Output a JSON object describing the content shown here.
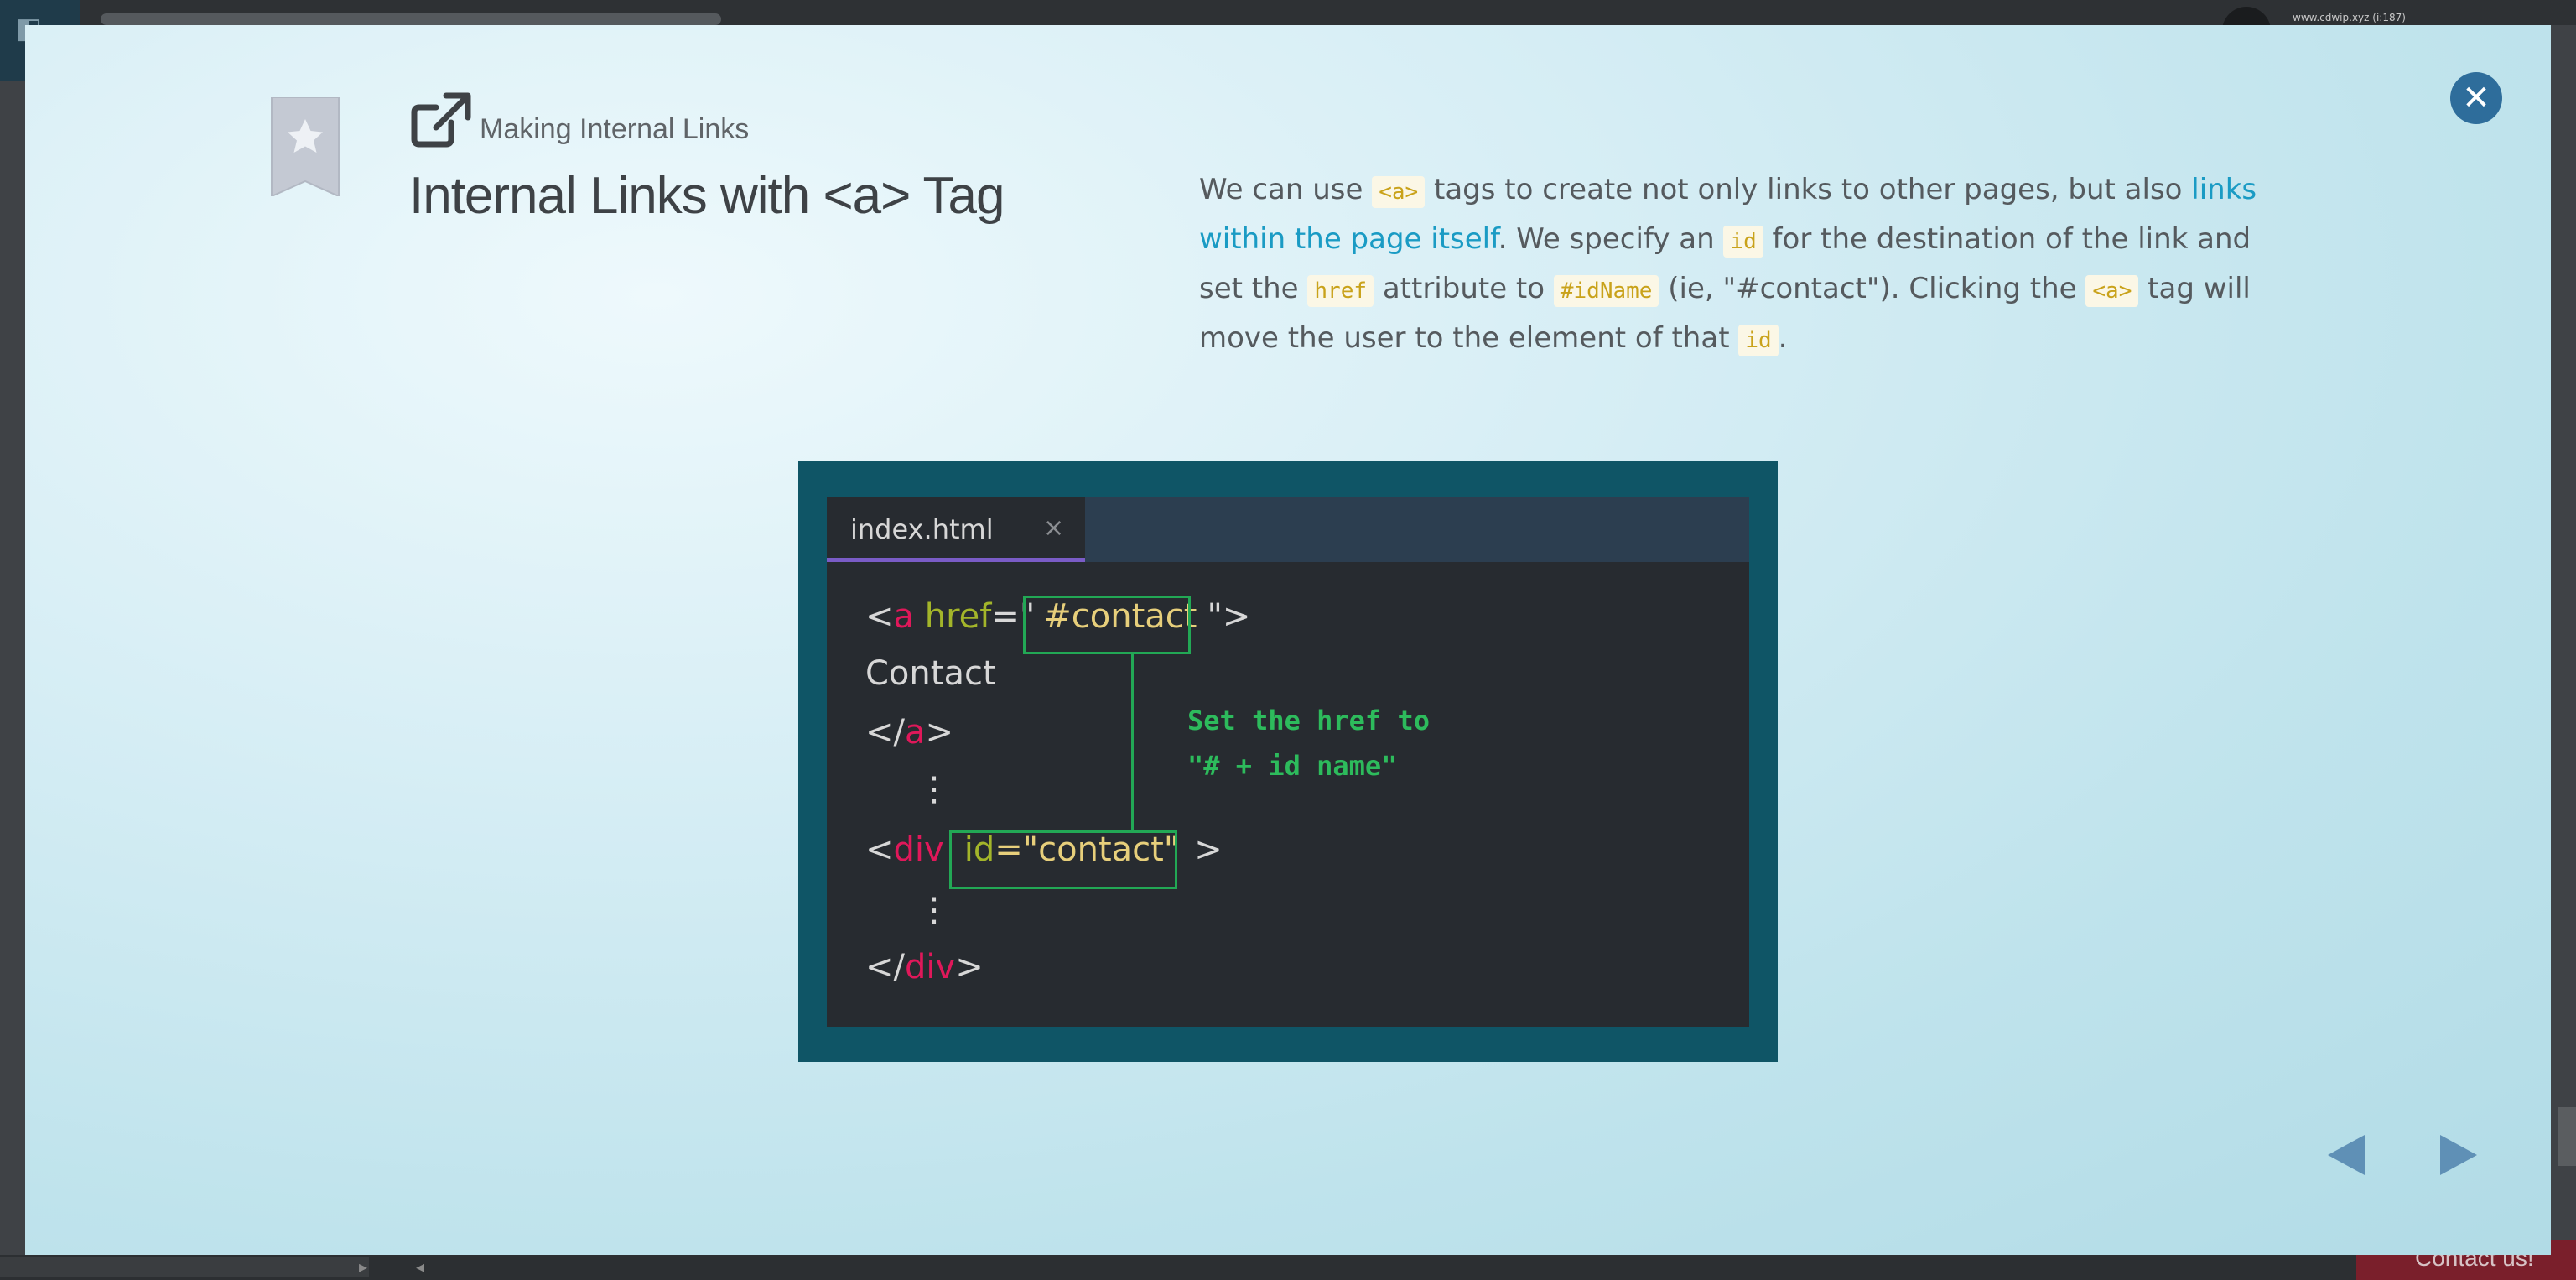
{
  "background": {
    "user_email": "www.cdwip.xyz (i:187)",
    "contact_label": "Contact us!"
  },
  "header": {
    "eyebrow": "Making Internal Links",
    "title": "Internal Links with <a> Tag"
  },
  "description": {
    "p1": "We can use ",
    "code_a1": "<a>",
    "p2": " tags to create not only links to other pages, but also ",
    "link_text": "links within the page itself",
    "p3": ". We specify an ",
    "code_id1": "id",
    "p4": " for the destination of the link and set the ",
    "code_href": "href",
    "p5": " attribute to ",
    "code_idname": "#idName",
    "p6": " (ie, \"#contact\"). Clicking the ",
    "code_a2": "<a>",
    "p7": " tag will move the user to the element of that ",
    "code_id2": "id",
    "p8": "."
  },
  "editor": {
    "tab_name": "index.html",
    "tab_close": "×",
    "line1": {
      "open": "<",
      "tag": "a",
      "attr": "href",
      "eq": "=\"",
      "value": "#contact",
      "close": "\">"
    },
    "line2": "Contact",
    "line3": {
      "open": "</",
      "tag": "a",
      "close": ">"
    },
    "dots": "⋮",
    "line5": {
      "open": "<",
      "tag": "div",
      "attr": "id",
      "eq": "=",
      "value": "\"contact\"",
      "close": ">"
    },
    "line7": {
      "open": "</",
      "tag": "div",
      "close": ">"
    },
    "annotation_line1": "Set the href to",
    "annotation_line2": "\"# + id name\""
  },
  "icons": {
    "bookmark": "bookmark-star-icon",
    "external_link": "external-link-icon",
    "close": "close-icon",
    "prev": "triangle-left-icon",
    "next": "triangle-right-icon"
  },
  "colors": {
    "accent_blue": "#2e6d9b",
    "link": "#1a9bc4",
    "code_text": "#c9a21a",
    "figure_frame": "#0f5566",
    "tag_red": "#e0185a",
    "attr_green": "#a3b52a",
    "string_yellow": "#e7cf7b",
    "annotation_green": "#2dbb5c"
  }
}
